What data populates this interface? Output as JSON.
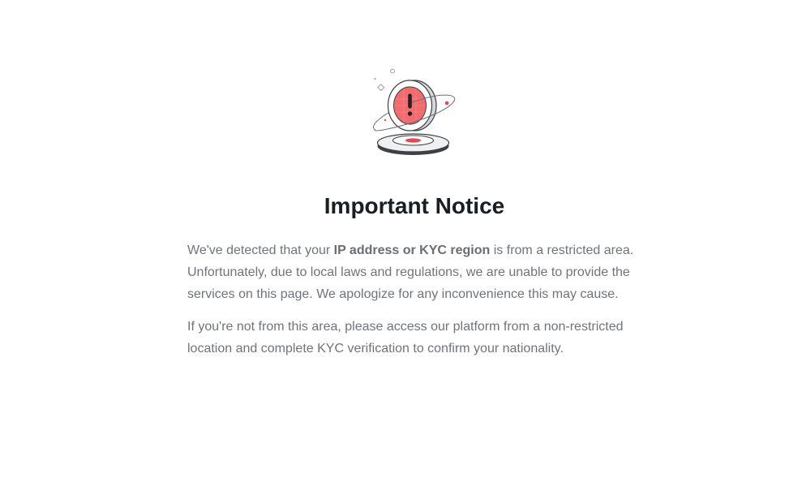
{
  "notice": {
    "illustration_icon": "restricted-region-warning-icon",
    "accent_color": "#e8484b",
    "title": "Important Notice",
    "paragraph1": {
      "before": "We've detected that your ",
      "emphasis": "IP address or KYC region",
      "after": " is from a restricted area. Unfortunately, due to local laws and regulations, we are unable to provide the services on this page. We apologize for any inconvenience this may cause."
    },
    "paragraph2": "If you're not from this area, please access our platform from a non-restricted location and complete KYC verification to confirm your nationality."
  }
}
